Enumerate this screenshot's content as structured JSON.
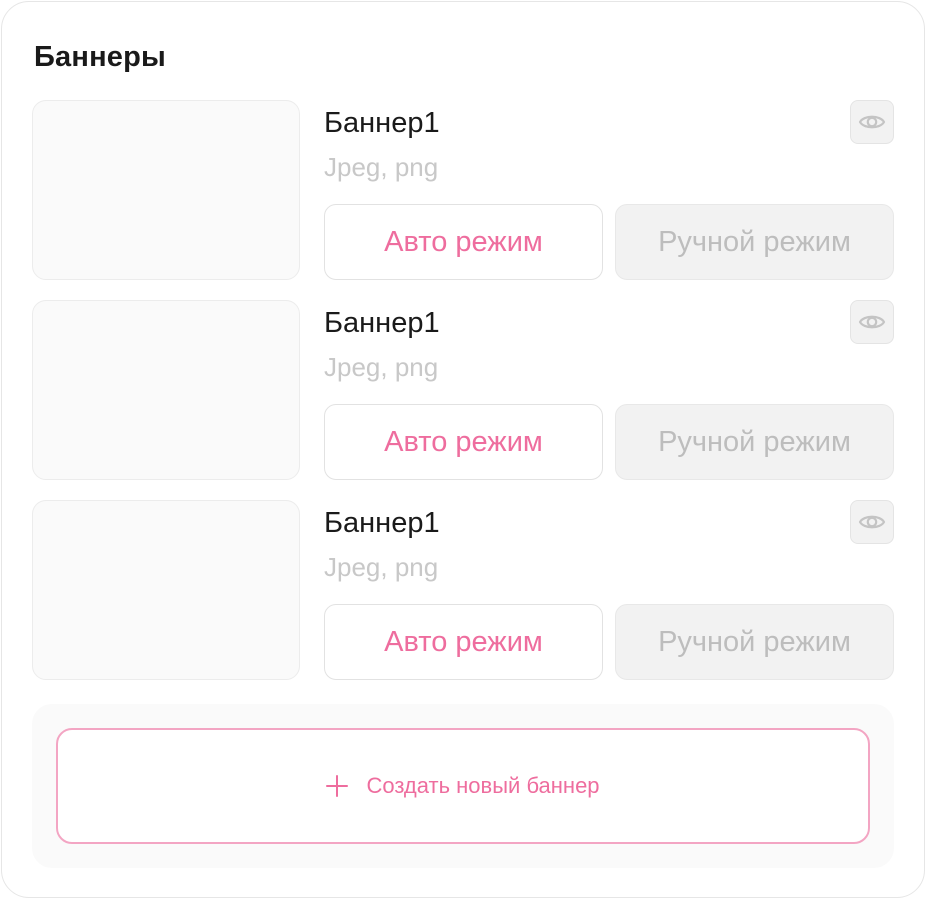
{
  "section": {
    "title": "Баннеры"
  },
  "banners": [
    {
      "name": "Баннер1",
      "formats": "Jpeg, png",
      "auto_label": "Авто режим",
      "manual_label": "Ручной режим",
      "preview_icon": "eye-icon"
    },
    {
      "name": "Баннер1",
      "formats": "Jpeg, png",
      "auto_label": "Авто режим",
      "manual_label": "Ручной режим",
      "preview_icon": "eye-icon"
    },
    {
      "name": "Баннер1",
      "formats": "Jpeg, png",
      "auto_label": "Авто режим",
      "manual_label": "Ручной режим",
      "preview_icon": "eye-icon"
    }
  ],
  "create": {
    "label": "Создать новый баннер",
    "icon": "plus-icon"
  },
  "colors": {
    "accent": "#ee6d9e",
    "accent_border": "#f3a5c3",
    "muted_text": "#c8c8c8",
    "disabled_bg": "#f2f2f2"
  }
}
